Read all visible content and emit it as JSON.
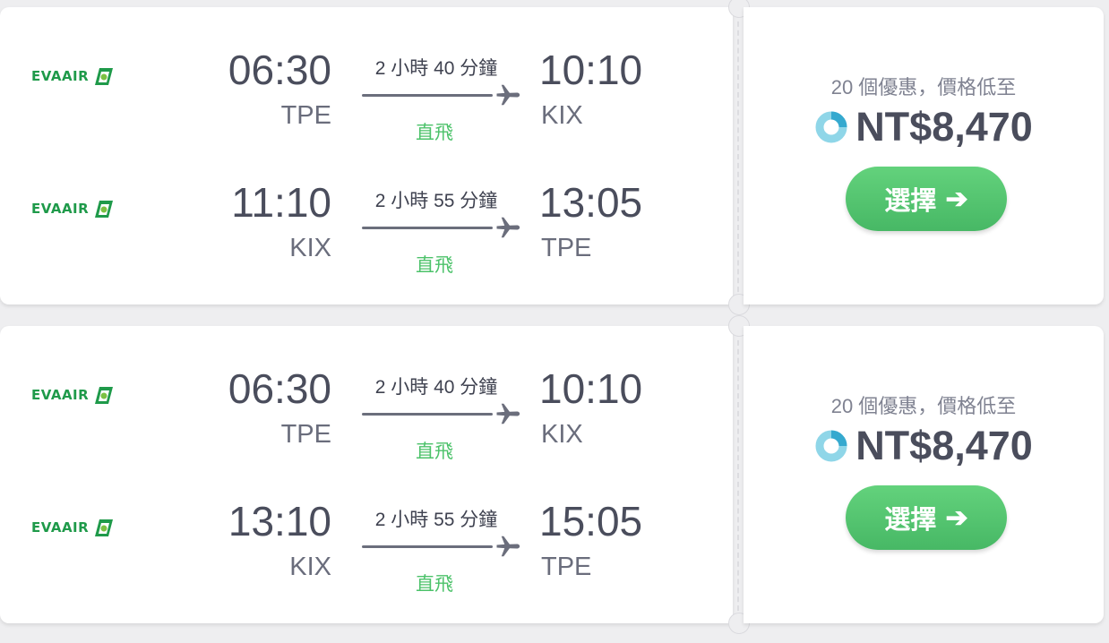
{
  "results": [
    {
      "legs": [
        {
          "airline": "EVAAIR",
          "dep_time": "06:30",
          "dep_code": "TPE",
          "duration": "2 小時 40 分鐘",
          "nonstop": "直飛",
          "arr_time": "10:10",
          "arr_code": "KIX"
        },
        {
          "airline": "EVAAIR",
          "dep_time": "11:10",
          "dep_code": "KIX",
          "duration": "2 小時 55 分鐘",
          "nonstop": "直飛",
          "arr_time": "13:05",
          "arr_code": "TPE"
        }
      ],
      "deals_text": "20 個優惠，價格低至",
      "price": "NT$8,470",
      "select_label": "選擇",
      "select_arrow": "➔"
    },
    {
      "legs": [
        {
          "airline": "EVAAIR",
          "dep_time": "06:30",
          "dep_code": "TPE",
          "duration": "2 小時 40 分鐘",
          "nonstop": "直飛",
          "arr_time": "10:10",
          "arr_code": "KIX"
        },
        {
          "airline": "EVAAIR",
          "dep_time": "13:10",
          "dep_code": "KIX",
          "duration": "2 小時 55 分鐘",
          "nonstop": "直飛",
          "arr_time": "15:05",
          "arr_code": "TPE"
        }
      ],
      "deals_text": "20 個優惠，價格低至",
      "price": "NT$8,470",
      "select_label": "選擇",
      "select_arrow": "➔"
    }
  ],
  "colors": {
    "accent_green": "#4cc26a",
    "button_green": "#55c46f",
    "text_dark": "#4a4d5c",
    "text_muted": "#7f8291",
    "eva_green": "#1f9a4a"
  },
  "icons": {
    "airline_logo": "eva-air-logo",
    "plane": "plane-icon",
    "provider": "provider-ring-icon",
    "arrow": "arrow-right-icon"
  }
}
